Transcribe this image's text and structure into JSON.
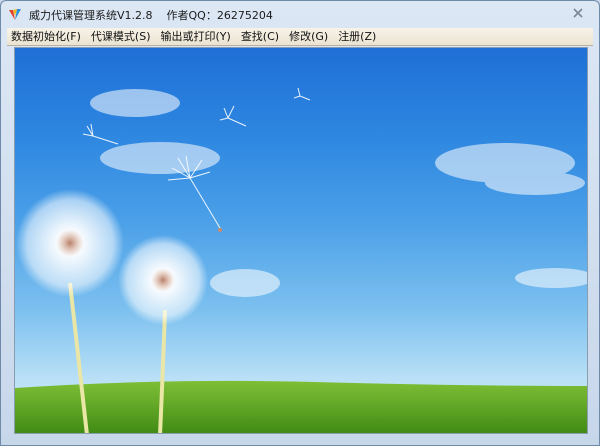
{
  "window": {
    "title": "威力代课管理系统V1.2.8",
    "author": "作者QQ：26275204"
  },
  "menu": {
    "items": [
      {
        "label": "数据初始化(F)"
      },
      {
        "label": "代课模式(S)"
      },
      {
        "label": "输出或打印(Y)"
      },
      {
        "label": "查找(C)"
      },
      {
        "label": "修改(G)"
      },
      {
        "label": "注册(Z)"
      }
    ]
  },
  "colors": {
    "sky_top": "#1f6fd6",
    "sky_bottom": "#d9f0fa",
    "grass": "#4f9a1c",
    "menubar": "#f1ebdc"
  },
  "icons": {
    "app": "app-logo-icon",
    "close": "close-icon"
  }
}
